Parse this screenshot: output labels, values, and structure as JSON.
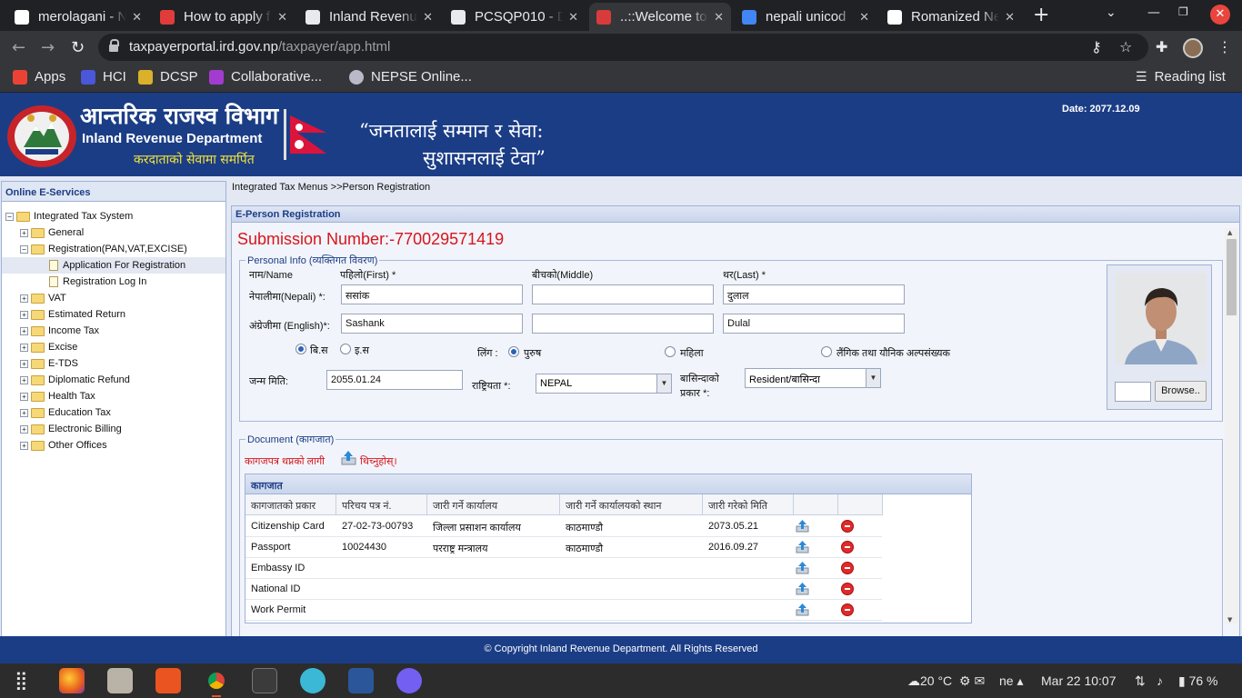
{
  "browser": {
    "tabs": [
      {
        "title": "merolagani - N",
        "favicon_color": "#ffffff"
      },
      {
        "title": "How to apply f",
        "favicon_color": "#e23b3b"
      },
      {
        "title": "Inland Revenu",
        "favicon_color": "#e8eaed"
      },
      {
        "title": "PCSQP010 - D",
        "favicon_color": "#e8eaed"
      },
      {
        "title": "..::Welcome to",
        "favicon_color": "#d83b3b"
      },
      {
        "title": "nepali unicod",
        "favicon_color": "#4285f4"
      },
      {
        "title": "Romanized Ne",
        "favicon_color": "#ffffff"
      }
    ],
    "active_tab_index": 4,
    "url_host": "taxpayerportal.ird.gov.np",
    "url_path": "/taxpayer/app.html",
    "bookmarks": [
      {
        "label": "Apps",
        "icon": "apps-grid-icon",
        "color": "#ea4335"
      },
      {
        "label": "HCI",
        "icon": "user-square-icon",
        "color": "#4a57d8"
      },
      {
        "label": "DCSP",
        "icon": "photo-icon",
        "color": "#d9b12a"
      },
      {
        "label": "Collaborative...",
        "icon": "user-square-icon",
        "color": "#a43bd0"
      },
      {
        "label": "NEPSE Online...",
        "icon": "globe-icon",
        "color": "#b9b9c8"
      }
    ],
    "reading_list": "Reading list"
  },
  "header": {
    "title_np": "आन्तरिक राजस्व विभाग",
    "title_en": "Inland Revenue Department",
    "tagline": "करदाताको सेवामा समर्पित",
    "slogan_line1": "“जनतालाई सम्मान र सेवा:",
    "slogan_line2": "सुशासनलाई टेवा”",
    "date": "Date:  2077.12.09"
  },
  "sidebar": {
    "title": "Online E-Services",
    "tree": [
      {
        "label": "Integrated Tax System",
        "level": 0,
        "expander": "−",
        "kind": "folder"
      },
      {
        "label": "General",
        "level": 1,
        "expander": "+",
        "kind": "folder"
      },
      {
        "label": "Registration(PAN,VAT,EXCISE)",
        "level": 1,
        "expander": "−",
        "kind": "folder"
      },
      {
        "label": "Application For Registration",
        "level": 2,
        "expander": "",
        "kind": "doc",
        "selected": true
      },
      {
        "label": "Registration Log In",
        "level": 2,
        "expander": "",
        "kind": "doc"
      },
      {
        "label": "VAT",
        "level": 1,
        "expander": "+",
        "kind": "folder"
      },
      {
        "label": "Estimated Return",
        "level": 1,
        "expander": "+",
        "kind": "folder"
      },
      {
        "label": "Income Tax",
        "level": 1,
        "expander": "+",
        "kind": "folder"
      },
      {
        "label": "Excise",
        "level": 1,
        "expander": "+",
        "kind": "folder"
      },
      {
        "label": "E-TDS",
        "level": 1,
        "expander": "+",
        "kind": "folder"
      },
      {
        "label": "Diplomatic Refund",
        "level": 1,
        "expander": "+",
        "kind": "folder"
      },
      {
        "label": "Health Tax",
        "level": 1,
        "expander": "+",
        "kind": "folder"
      },
      {
        "label": "Education Tax",
        "level": 1,
        "expander": "+",
        "kind": "folder"
      },
      {
        "label": "Electronic Billing",
        "level": 1,
        "expander": "+",
        "kind": "folder"
      },
      {
        "label": "Other Offices",
        "level": 1,
        "expander": "+",
        "kind": "folder"
      }
    ]
  },
  "breadcrumb": "Integrated Tax Menus >>Person Registration",
  "panel_title": "E-Person Registration",
  "submission": "Submission Number:-770029571419",
  "personal": {
    "legend": "Personal Info (व्यक्तिगत विवरण)",
    "name_label": "नाम/Name",
    "first_label": "पहिलो(First) *",
    "middle_label": "बीचको(Middle)",
    "last_label": "थर(Last) *",
    "nepali_label": "नेपालीमा(Nepali) *:",
    "english_label": "अंग्रेजीमा (English)*:",
    "first_np": "ससांक",
    "middle_np": "",
    "last_np": "दुलाल",
    "first_en": "Sashank",
    "middle_en": "",
    "last_en": "Dulal",
    "calendar_bs": "बि.स",
    "calendar_ad": "इ.स",
    "gender_label": "लिंग :",
    "gender_male": "पुरुष",
    "gender_female": "महिला",
    "gender_other": "लैंगिक तथा यौनिक अल्पसंख्यक",
    "dob_label": "जन्म मिति:",
    "dob": "2055.01.24",
    "nationality_label": "राष्ट्रियता *:",
    "nationality": "NEPAL",
    "resident_label_1": "बासिन्दाको",
    "resident_label_2": "प्रकार *:",
    "resident": "Resident/बासिन्दा",
    "browse": "Browse.."
  },
  "document": {
    "legend": "Document (कागजात)",
    "upload_prefix": "कागजपत्र थप्नको लागी",
    "upload_link": "थिच्नुहोस्।",
    "table_title": "कागजात",
    "columns": [
      "कागजातको प्रकार",
      "परिचय पत्र नं.",
      "जारी गर्ने कार्यालय",
      "जारी गर्ने कार्यालयको स्थान",
      "जारी गरेको मिति",
      "",
      ""
    ],
    "rows": [
      {
        "type": "Citizenship Card",
        "number": "27-02-73-00793",
        "office": "जिल्ला प्रसाशन कार्यालय",
        "location": "काठमाण्डौ",
        "date": "2073.05.21"
      },
      {
        "type": "Passport",
        "number": "10024430",
        "office": "परराष्ट्र मन्त्रालय",
        "location": "काठमाण्डौ",
        "date": "2016.09.27"
      },
      {
        "type": "Embassy ID",
        "number": "",
        "office": "",
        "location": "",
        "date": ""
      },
      {
        "type": "National ID",
        "number": "",
        "office": "",
        "location": "",
        "date": ""
      },
      {
        "type": "Work Permit",
        "number": "",
        "office": "",
        "location": "",
        "date": ""
      }
    ]
  },
  "footer": "© Copyright Inland Revenue Department. All Rights Reserved",
  "taskbar": {
    "temperature": "20 °C",
    "language": "ne",
    "datetime": "Mar 22  10:07",
    "battery": "76 %"
  }
}
